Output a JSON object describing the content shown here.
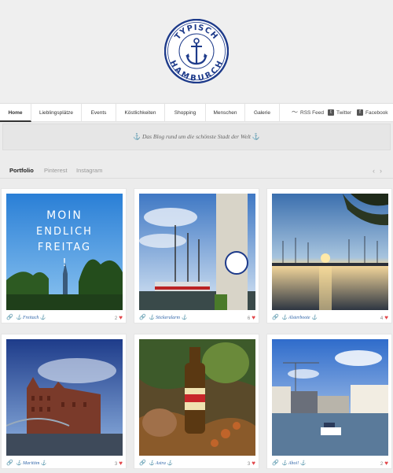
{
  "logo": {
    "arc_top": "TYPISCH",
    "arc_bottom": "HAMBURCH"
  },
  "nav": {
    "items": [
      {
        "label": "Home"
      },
      {
        "label": "Lieblingsplätze"
      },
      {
        "label": "Events"
      },
      {
        "label": "Köstlichkeiten"
      },
      {
        "label": "Shopping"
      },
      {
        "label": "Menschen"
      },
      {
        "label": "Galerie"
      }
    ],
    "social": [
      {
        "label": "RSS Feed",
        "icon": "rss-icon"
      },
      {
        "label": "Twitter",
        "icon": "twitter-icon"
      },
      {
        "label": "Facebook",
        "icon": "facebook-icon"
      }
    ]
  },
  "tagline": {
    "anchor": "⚓",
    "text": " Das Blog rund um die schönste Stadt der Welt "
  },
  "tabs": [
    {
      "label": "Portfolio"
    },
    {
      "label": "Pinterest"
    },
    {
      "label": "Instagram"
    }
  ],
  "pager": {
    "prev": "‹",
    "next": "›"
  },
  "colors": {
    "accent": "#2f64a8",
    "heart": "#e2474b"
  },
  "cards": [
    {
      "title": "Freitach",
      "likes": "2",
      "photo_text": [
        "MOIN",
        "ENDLICH",
        "FREITAG",
        "!"
      ]
    },
    {
      "title": "Stickeralarm",
      "likes": "6"
    },
    {
      "title": "Alsterboote",
      "likes": "4"
    },
    {
      "title": "Marittim",
      "likes": "3"
    },
    {
      "title": "Astra",
      "likes": "3"
    },
    {
      "title": "Ahoi!",
      "likes": "2"
    }
  ]
}
